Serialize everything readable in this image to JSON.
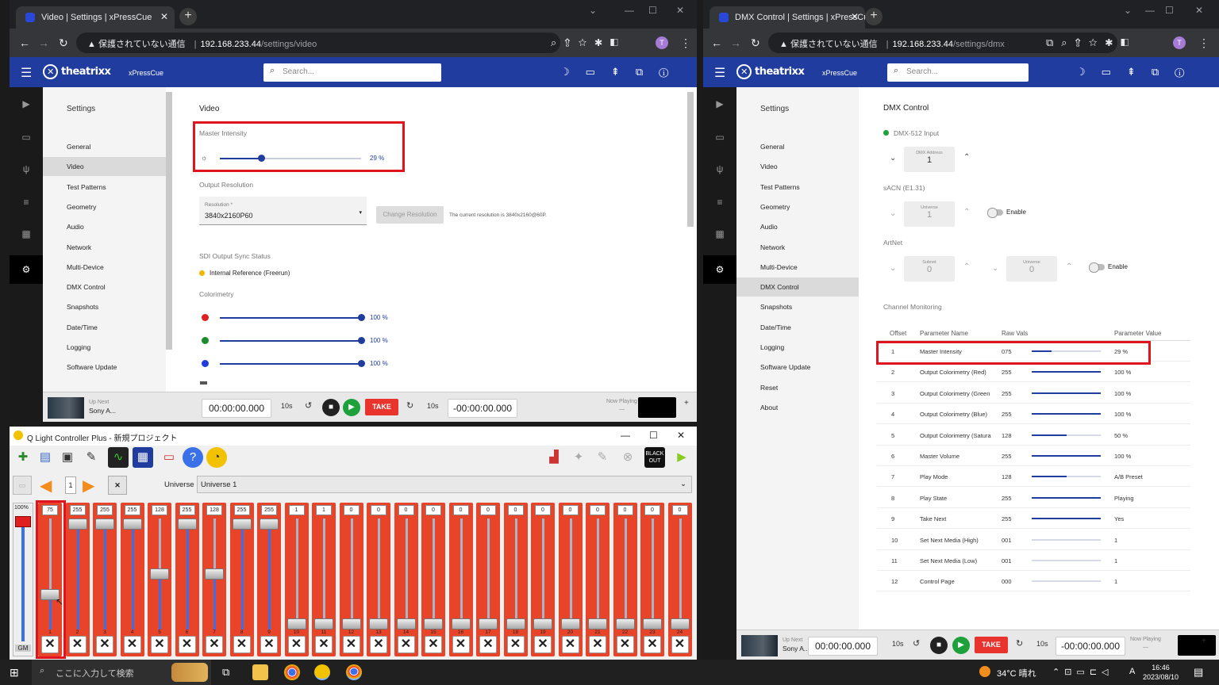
{
  "left_browser": {
    "tab_title": "Video | Settings | xPressCue",
    "address_warning": "▲ 保護されていない通信",
    "url_host": "192.168.233.44",
    "url_path": "/settings/video",
    "profile_initial": "T"
  },
  "right_browser": {
    "tab_title": "DMX Control | Settings | xPressCu",
    "address_warning": "▲ 保護されていない通信",
    "url_host": "192.168.233.44",
    "url_path": "/settings/dmx",
    "profile_initial": "T"
  },
  "app": {
    "logo": "theatrixx",
    "product": "xPressCue",
    "search_placeholder": "Search..."
  },
  "sidebar": {
    "title": "Settings",
    "items_left": [
      "General",
      "Video",
      "Test Patterns",
      "Geometry",
      "Audio",
      "Network",
      "Multi-Device",
      "DMX Control",
      "Snapshots",
      "Date/Time",
      "Logging",
      "Software Update"
    ],
    "items_right": [
      "General",
      "Video",
      "Test Patterns",
      "Geometry",
      "Audio",
      "Network",
      "Multi-Device",
      "DMX Control",
      "Snapshots",
      "Date/Time",
      "Logging",
      "Software Update",
      "Reset",
      "About"
    ]
  },
  "video": {
    "title": "Video",
    "master_intensity_label": "Master Intensity",
    "master_intensity_value": "29 %",
    "master_intensity_level": 0.29,
    "output_resolution_label": "Output Resolution",
    "resolution_field_label": "Resolution *",
    "resolution_value": "3840x2160P60",
    "change_resolution_button": "Change Resolution",
    "current_resolution_note": "The current resolution is 3840x2160@60P.",
    "sdi_label": "SDI Output Sync Status",
    "sdi_status": "Internal Reference (Freerun)",
    "colorimetry_label": "Colorimetry",
    "colorimetry": [
      {
        "color": "#e02020",
        "value": "100 %"
      },
      {
        "color": "#1a8a2a",
        "value": "100 %"
      },
      {
        "color": "#1f3cdf",
        "value": "100 %"
      }
    ]
  },
  "player": {
    "up_next_label": "Up Next",
    "up_next_title": "Sony A...",
    "timecode": "00:00:00.000",
    "remaining": "-00:00:00.000",
    "skip_back": "10s",
    "skip_fwd": "10s",
    "take_label": "TAKE",
    "now_playing_label": "Now Playing",
    "now_playing_dash": "—"
  },
  "dmx": {
    "title": "DMX Control",
    "dmx512_label": "DMX-512 Input",
    "dmx_address_label": "DMX Address",
    "dmx_address_value": "1",
    "sacn_label": "sACN (E1.31)",
    "universe_label": "Universe",
    "universe_value": "1",
    "enable_label": "Enable",
    "artnet_label": "ArtNet",
    "subnet_label": "Subnet",
    "subnet_value": "0",
    "artnet_universe_label": "Universe",
    "artnet_universe_value": "0",
    "artnet_enable_label": "Enable",
    "monitoring_label": "Channel Monitoring",
    "headers": [
      "Offset",
      "Parameter Name",
      "Raw Vals",
      "Parameter Value"
    ],
    "rows": [
      {
        "offset": "1",
        "name": "Master Intensity",
        "raw": "075",
        "level": 0.29,
        "value": "29 %"
      },
      {
        "offset": "2",
        "name": "Output Colorimetry (Red)",
        "raw": "255",
        "level": 1.0,
        "value": "100 %"
      },
      {
        "offset": "3",
        "name": "Output Colorimetry (Green",
        "raw": "255",
        "level": 1.0,
        "value": "100 %"
      },
      {
        "offset": "4",
        "name": "Output Colorimetry (Blue)",
        "raw": "255",
        "level": 1.0,
        "value": "100 %"
      },
      {
        "offset": "5",
        "name": "Output Colorimetry (Satura",
        "raw": "128",
        "level": 0.5,
        "value": "50 %"
      },
      {
        "offset": "6",
        "name": "Master Volume",
        "raw": "255",
        "level": 1.0,
        "value": "100 %"
      },
      {
        "offset": "7",
        "name": "Play Mode",
        "raw": "128",
        "level": 0.5,
        "value": "A/B Preset"
      },
      {
        "offset": "8",
        "name": "Play State",
        "raw": "255",
        "level": 1.0,
        "value": "Playing"
      },
      {
        "offset": "9",
        "name": "Take Next",
        "raw": "255",
        "level": 1.0,
        "value": "Yes"
      },
      {
        "offset": "10",
        "name": "Set Next Media (High)",
        "raw": "001",
        "level": 0.0,
        "value": "1"
      },
      {
        "offset": "11",
        "name": "Set Next Media (Low)",
        "raw": "001",
        "level": 0.0,
        "value": "1"
      },
      {
        "offset": "12",
        "name": "Control Page",
        "raw": "000",
        "level": 0.0,
        "value": "1"
      }
    ]
  },
  "qlc": {
    "title": "Q Light Controller Plus - 新規プロジェクト",
    "page_number": "1",
    "universe_label": "Universe",
    "universe_value": "Universe 1",
    "gm_label": "GM",
    "gm_value": "100%",
    "blackout_label": "BLACK OUT",
    "channels": [
      {
        "num": "1",
        "value": "75",
        "level": 0.29
      },
      {
        "num": "2",
        "value": "255",
        "level": 1.0
      },
      {
        "num": "3",
        "value": "255",
        "level": 1.0
      },
      {
        "num": "4",
        "value": "255",
        "level": 1.0
      },
      {
        "num": "5",
        "value": "128",
        "level": 0.5
      },
      {
        "num": "6",
        "value": "255",
        "level": 1.0
      },
      {
        "num": "7",
        "value": "128",
        "level": 0.5
      },
      {
        "num": "8",
        "value": "255",
        "level": 1.0
      },
      {
        "num": "9",
        "value": "255",
        "level": 1.0
      },
      {
        "num": "10",
        "value": "1",
        "level": 0.0
      },
      {
        "num": "11",
        "value": "1",
        "level": 0.0
      },
      {
        "num": "12",
        "value": "0",
        "level": 0.0
      },
      {
        "num": "13",
        "value": "0",
        "level": 0.0
      },
      {
        "num": "14",
        "value": "0",
        "level": 0.0
      },
      {
        "num": "15",
        "value": "0",
        "level": 0.0
      },
      {
        "num": "16",
        "value": "0",
        "level": 0.0
      },
      {
        "num": "17",
        "value": "0",
        "level": 0.0
      },
      {
        "num": "18",
        "value": "0",
        "level": 0.0
      },
      {
        "num": "19",
        "value": "0",
        "level": 0.0
      },
      {
        "num": "20",
        "value": "0",
        "level": 0.0
      },
      {
        "num": "21",
        "value": "0",
        "level": 0.0
      },
      {
        "num": "22",
        "value": "0",
        "level": 0.0
      },
      {
        "num": "23",
        "value": "0",
        "level": 0.0
      },
      {
        "num": "24",
        "value": "0",
        "level": 0.0
      }
    ]
  },
  "taskbar": {
    "search_placeholder": "ここに入力して検索",
    "weather": "34°C 晴れ",
    "ime": "A",
    "time": "16:46",
    "date": "2023/08/10"
  }
}
